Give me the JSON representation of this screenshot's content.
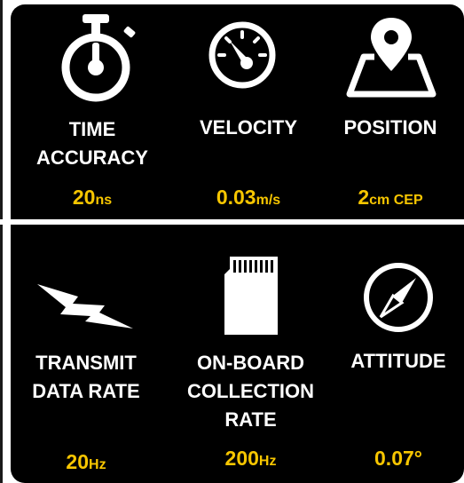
{
  "colors": {
    "background": "#000000",
    "label": "#ffffff",
    "value": "#f7c600"
  },
  "metrics": [
    {
      "icon": "stopwatch-icon",
      "label_lines": [
        "TIME",
        "ACCURACY"
      ],
      "value": "20",
      "unit": "ns"
    },
    {
      "icon": "speedometer-icon",
      "label_lines": [
        "VELOCITY"
      ],
      "value": "0.03",
      "unit": "m/s"
    },
    {
      "icon": "map-pin-icon",
      "label_lines": [
        "POSITION"
      ],
      "value": "2",
      "unit": "cm CEP"
    },
    {
      "icon": "lightning-bolt-icon",
      "label_lines": [
        "TRANSMIT",
        "DATA RATE"
      ],
      "value": "20",
      "unit": "Hz"
    },
    {
      "icon": "sd-card-icon",
      "label_lines": [
        "ON-BOARD",
        "COLLECTION",
        "RATE"
      ],
      "value": "200",
      "unit": "Hz"
    },
    {
      "icon": "compass-icon",
      "label_lines": [
        "ATTITUDE"
      ],
      "value": "0.07°",
      "unit": ""
    }
  ]
}
